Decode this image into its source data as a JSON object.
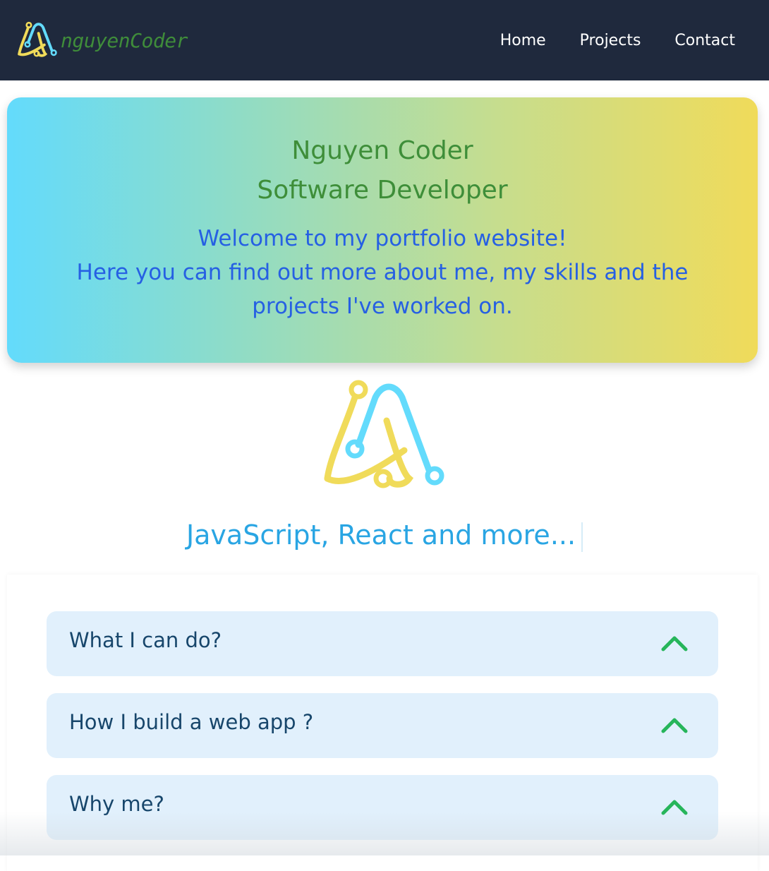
{
  "navbar": {
    "brand_text": "nguyenCoder",
    "links": [
      "Home",
      "Projects",
      "Contact"
    ]
  },
  "hero": {
    "name": "Nguyen Coder",
    "role": "Software Developer",
    "welcome_line1": "Welcome to my portfolio website!",
    "welcome_line2": "Here you can find out more about me, my skills and the projects I've worked on."
  },
  "tagline": "JavaScript, React and more...",
  "faq": {
    "items": [
      {
        "title": "What I can do?"
      },
      {
        "title": "How I build a web app ?"
      },
      {
        "title": "Why me?"
      }
    ]
  },
  "colors": {
    "navbar_bg": "#1f293d",
    "brand_green": "#3f8c3a",
    "logo_yellow": "#f0db5a",
    "logo_cyan": "#63dbfc",
    "welcome_blue": "#2660e3",
    "tagline_blue": "#29a5e3",
    "faq_bg": "#e1f0fc",
    "chevron_green": "#26b55a"
  },
  "icons": [
    "logo-icon",
    "chevron-up-icon"
  ]
}
